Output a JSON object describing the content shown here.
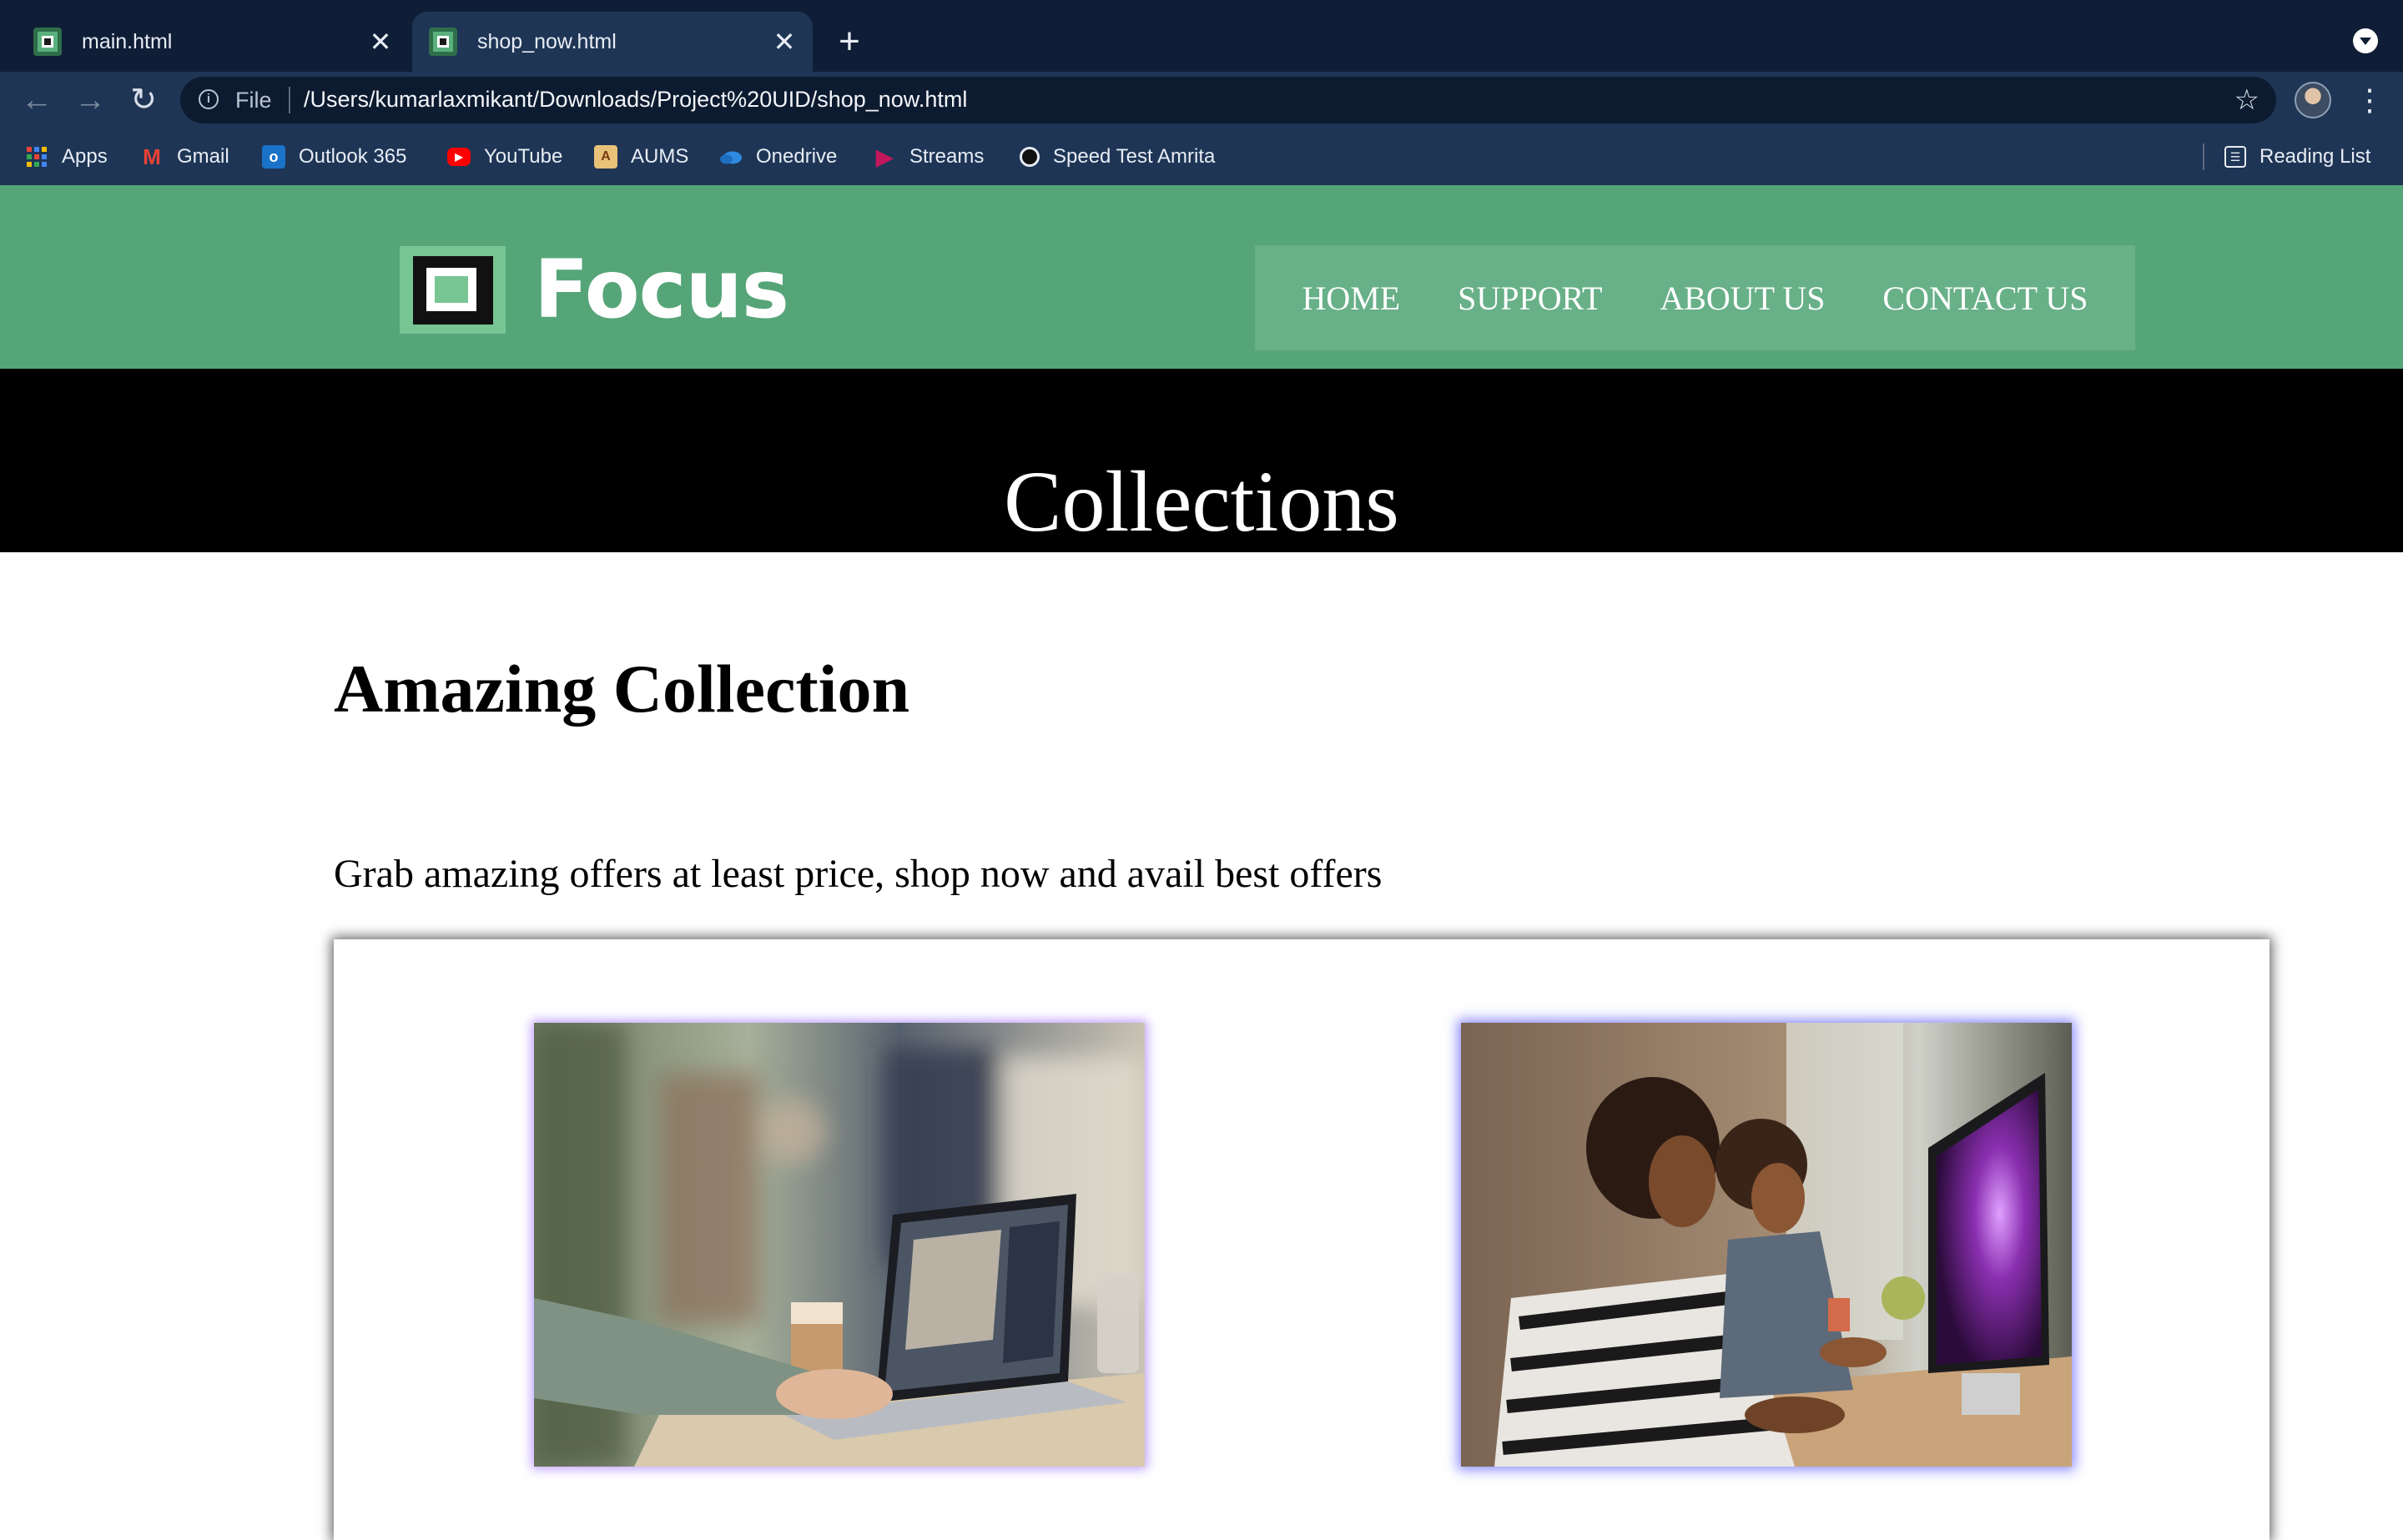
{
  "browser": {
    "tabs": [
      {
        "title": "main.html",
        "active": false
      },
      {
        "title": "shop_now.html",
        "active": true
      }
    ],
    "address_bar": {
      "scheme_label": "File",
      "url": "/Users/kumarlaxmikant/Downloads/Project%20UID/shop_now.html"
    },
    "bookmarks": [
      {
        "label": "Apps",
        "icon": "apps-grid-icon"
      },
      {
        "label": "Gmail",
        "icon": "gmail-icon"
      },
      {
        "label": "Outlook 365",
        "icon": "outlook-icon"
      },
      {
        "label": "YouTube",
        "icon": "youtube-icon"
      },
      {
        "label": "AUMS",
        "icon": "aums-icon"
      },
      {
        "label": "Onedrive",
        "icon": "onedrive-icon"
      },
      {
        "label": "Streams",
        "icon": "streams-icon"
      },
      {
        "label": "Speed Test Amrita",
        "icon": "speedtest-icon"
      }
    ],
    "reading_list_label": "Reading List",
    "colors": {
      "tab_strip": "#0f1e36",
      "toolbar": "#1e3555",
      "omnibox": "#0d1b30"
    }
  },
  "site": {
    "brand": "Focus",
    "nav": [
      {
        "label": "HOME"
      },
      {
        "label": "SUPPORT"
      },
      {
        "label": "ABOUT US"
      },
      {
        "label": "CONTACT US"
      }
    ],
    "banner_title": "Collections",
    "section_heading": "Amazing Collection",
    "section_subtext": "Grab amazing offers at least price, shop now and avail best offers",
    "colors": {
      "header": "#56a579",
      "nav_box": "#68b088",
      "logo_accent": "#77c593",
      "banner": "#000000"
    },
    "products": [
      {
        "image": "person-typing-on-laptop-with-coffee-photo"
      },
      {
        "image": "family-at-desktop-computer-photo"
      }
    ]
  }
}
